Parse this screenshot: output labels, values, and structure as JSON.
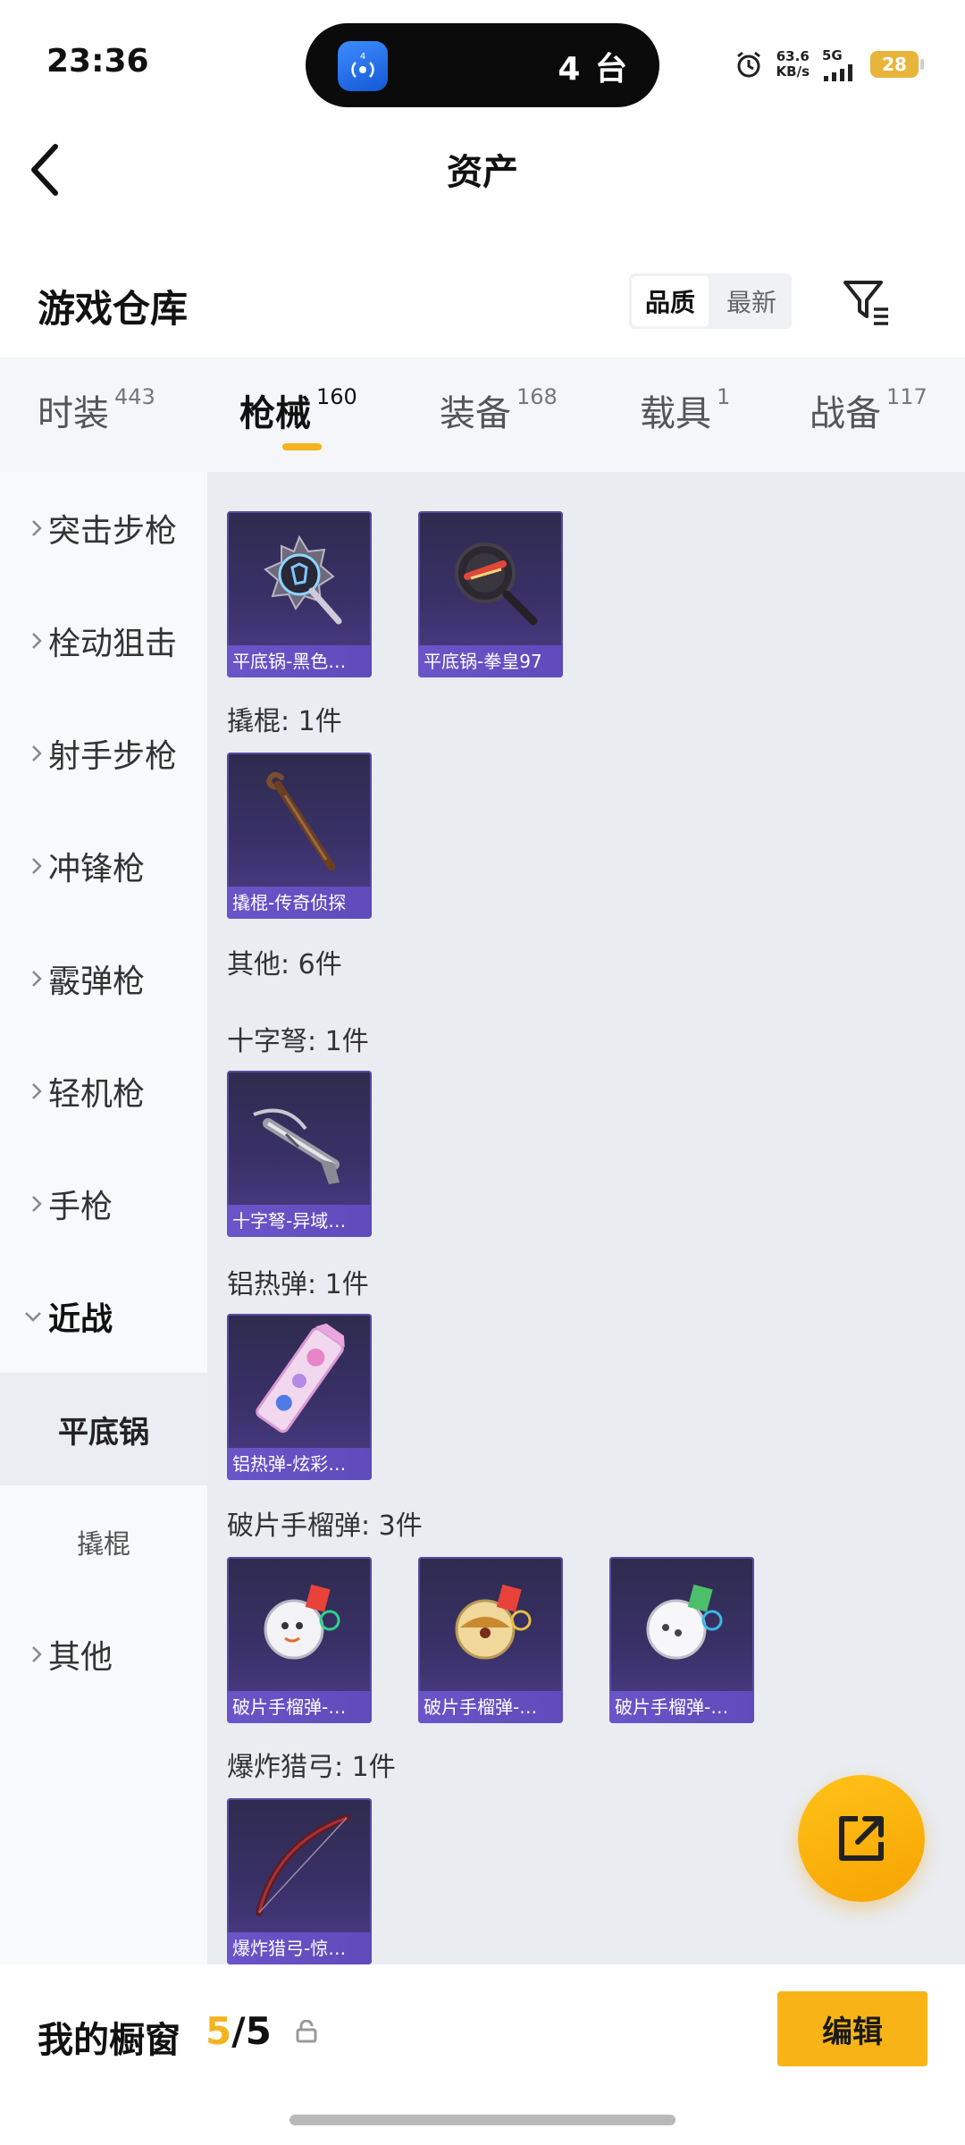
{
  "status_bar": {
    "time": "23:36",
    "island_count": "4 台",
    "island_badge": "4",
    "net_speed_value": "63.6",
    "net_speed_unit": "KB/s",
    "net_type": "5G",
    "battery": "28"
  },
  "header": {
    "title": "资产"
  },
  "warehouse": {
    "title": "游戏仓库",
    "sort_options": [
      "品质",
      "最新"
    ],
    "active_sort": "品质"
  },
  "tabs": [
    {
      "label": "时装",
      "count": "443"
    },
    {
      "label": "枪械",
      "count": "160",
      "active": true
    },
    {
      "label": "装备",
      "count": "168"
    },
    {
      "label": "载具",
      "count": "1"
    },
    {
      "label": "战备",
      "count": "117"
    }
  ],
  "sidebar": {
    "categories": [
      "突击步枪",
      "栓动狙击",
      "射手步枪",
      "冲锋枪",
      "霰弹枪",
      "轻机枪",
      "手枪"
    ],
    "expanded": "近战",
    "sub_items": [
      "平底锅",
      "撬棍"
    ],
    "selected_sub": "平底锅",
    "last": "其他"
  },
  "content": {
    "top_items": [
      "平底锅-黑色…",
      "平底锅-拳皇97"
    ],
    "sections": [
      {
        "label": "撬棍: 1件",
        "items": [
          "撬棍-传奇侦探"
        ]
      },
      {
        "label": "其他: 6件",
        "items": []
      },
      {
        "label": "十字弩: 1件",
        "items": [
          "十字弩-异域…"
        ]
      },
      {
        "label": "铝热弹: 1件",
        "items": [
          "铝热弹-炫彩…"
        ]
      },
      {
        "label": "破片手榴弹: 3件",
        "items": [
          "破片手榴弹-…",
          "破片手榴弹-…",
          "破片手榴弹-…"
        ]
      },
      {
        "label": "爆炸猎弓: 1件",
        "items": [
          "爆炸猎弓-惊…"
        ]
      }
    ]
  },
  "bottom": {
    "showcase_label": "我的橱窗",
    "showcase_current": "5",
    "showcase_total": "/5",
    "edit_label": "编辑"
  },
  "colors": {
    "accent": "#f8b417",
    "card_bg": "#3a3168",
    "card_label_bg": "#6a55c9"
  },
  "icons": [
    "back-icon",
    "filter-icon",
    "chevron-right-icon",
    "chevron-down-icon",
    "share-icon",
    "lock-icon",
    "alarm-icon",
    "signal-icon",
    "broadcast-icon"
  ]
}
